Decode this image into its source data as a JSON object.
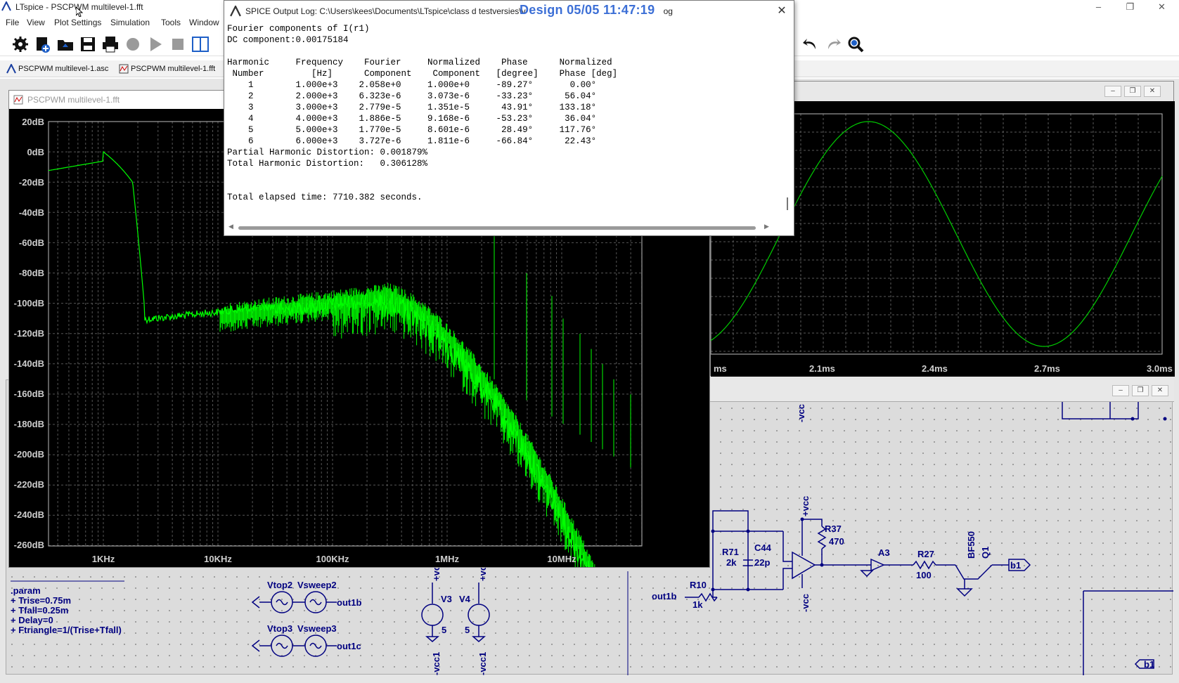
{
  "window": {
    "title": "LTspice - PSCPWM multilevel-1.fft",
    "controls": [
      "–",
      "❐",
      "✕"
    ]
  },
  "menu": [
    "File",
    "View",
    "Plot Settings",
    "Simulation",
    "Tools",
    "Window"
  ],
  "tabs": [
    {
      "label": "PSCPWM multilevel-1.asc",
      "icon": "schematic-icon"
    },
    {
      "label": "PSCPWM multilevel-1.fft",
      "icon": "waveform-icon"
    }
  ],
  "fft_window": {
    "title": "PSCPWM multilevel-1.fft",
    "y_ticks": [
      "20dB",
      "0dB",
      "-20dB",
      "-40dB",
      "-60dB",
      "-80dB",
      "-100dB",
      "-120dB",
      "-140dB",
      "-160dB",
      "-180dB",
      "-200dB",
      "-220dB",
      "-240dB",
      "-260dB"
    ],
    "x_ticks": [
      "1KHz",
      "10KHz",
      "100KHz",
      "1MHz",
      "10MHz"
    ],
    "trace_color": "#00ff00"
  },
  "time_window": {
    "x_ticks": [
      "ms",
      "2.1ms",
      "2.4ms",
      "2.7ms",
      "3.0ms"
    ],
    "trace_color": "#00cc00"
  },
  "log": {
    "title": "SPICE Output Log: C:\\Users\\kees\\Documents\\LTspice\\class d testversies\\v",
    "title_suffix": "og",
    "stamp": "Design 05/05 11:47:19",
    "close": "✕",
    "lines": [
      "Fourier components of I(r1)",
      "DC component:0.00175184",
      "",
      "Harmonic     Frequency    Fourier     Normalized    Phase      Normalized",
      " Number         [Hz]      Component    Component   [degree]    Phase [deg]",
      "    1        1.000e+3    2.058e+0     1.000e+0     -89.27°       0.00°",
      "    2        2.000e+3    6.323e-6     3.073e-6     -33.23°      56.04°",
      "    3        3.000e+3    2.779e-5     1.351e-5      43.91°     133.18°",
      "    4        4.000e+3    1.886e-5     9.168e-6     -53.23°      36.04°",
      "    5        5.000e+3    1.770e-5     8.601e-6      28.49°     117.76°",
      "    6        6.000e+3    3.727e-6     1.811e-6     -66.84°      22.43°",
      "Partial Harmonic Distortion: 0.001879%",
      "Total Harmonic Distortion:   0.306128%",
      "",
      "",
      "Total elapsed time: 7710.382 seconds."
    ]
  },
  "schematic": {
    "param_block": [
      ".param",
      "+ Trise=0.75m",
      "+ Tfall=0.25m",
      "+ Delay=0",
      "+ Ftriangle=1/(Trise+Tfall)"
    ],
    "labels": {
      "vtop2": "Vtop2",
      "vsweep2": "Vsweep2",
      "out1b": "out1b",
      "vtop3": "Vtop3",
      "vsweep3": "Vsweep3",
      "out1c": "out1c",
      "v3": "V3",
      "v4": "V4",
      "v3val": "5",
      "v4val": "5",
      "vcc": "+vcc",
      "nvcc": "-vcc",
      "vcc1": "-vcc1",
      "r71": "R71",
      "r71v": "2k",
      "c44": "C44",
      "c44v": "22p",
      "r10": "R10",
      "r10v": "1k",
      "out1b_net": "out1b",
      "r37": "R37",
      "r37v": "470",
      "a3": "A3",
      "r27": "R27",
      "r27v": "100",
      "bf550": "BF550",
      "q1": "Q1",
      "b1": "b1",
      "b1b": "b1"
    }
  }
}
